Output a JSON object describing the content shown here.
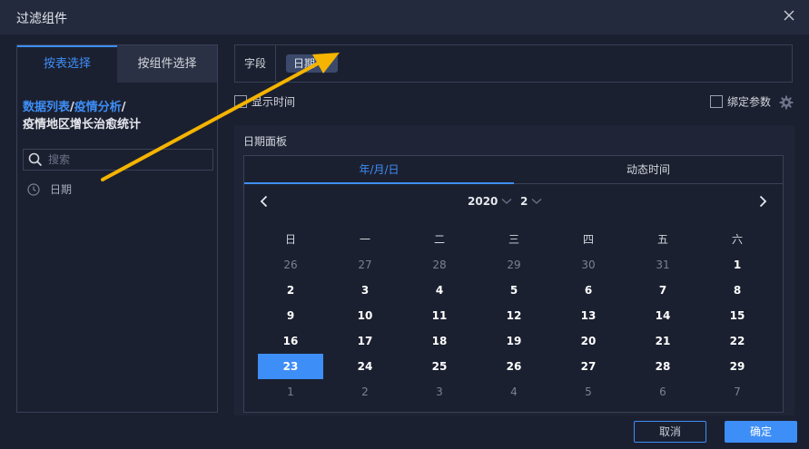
{
  "dialog": {
    "title": "过滤组件"
  },
  "left_panel": {
    "tabs": [
      {
        "label": "按表选择",
        "active": true
      },
      {
        "label": "按组件选择",
        "active": false
      }
    ],
    "breadcrumb": {
      "part1": "数据列表",
      "sep1": "/",
      "part2": "疫情分析",
      "sep2": "/",
      "part3": "疫情地区增长治愈统计"
    },
    "search": {
      "placeholder": "搜索",
      "value": ""
    },
    "fields": [
      {
        "label": "日期",
        "icon": "clock-icon"
      }
    ]
  },
  "field_row": {
    "label": "字段",
    "selected": "日期"
  },
  "options": {
    "show_time_label": "显示时间",
    "show_time_checked": false,
    "bind_param_label": "绑定参数",
    "bind_param_checked": false
  },
  "date_panel": {
    "title": "日期面板",
    "tabs": [
      {
        "label": "年/月/日",
        "active": true
      },
      {
        "label": "动态时间",
        "active": false
      }
    ],
    "year": "2020",
    "month": "2",
    "weekdays": [
      "日",
      "一",
      "二",
      "三",
      "四",
      "五",
      "六"
    ],
    "weeks": [
      [
        {
          "d": "26",
          "o": true
        },
        {
          "d": "27",
          "o": true
        },
        {
          "d": "28",
          "o": true
        },
        {
          "d": "29",
          "o": true
        },
        {
          "d": "30",
          "o": true
        },
        {
          "d": "31",
          "o": true
        },
        {
          "d": "1",
          "o": false
        }
      ],
      [
        {
          "d": "2",
          "o": false
        },
        {
          "d": "3",
          "o": false
        },
        {
          "d": "4",
          "o": false
        },
        {
          "d": "5",
          "o": false
        },
        {
          "d": "6",
          "o": false
        },
        {
          "d": "7",
          "o": false
        },
        {
          "d": "8",
          "o": false
        }
      ],
      [
        {
          "d": "9",
          "o": false
        },
        {
          "d": "10",
          "o": false
        },
        {
          "d": "11",
          "o": false
        },
        {
          "d": "12",
          "o": false
        },
        {
          "d": "13",
          "o": false
        },
        {
          "d": "14",
          "o": false
        },
        {
          "d": "15",
          "o": false
        }
      ],
      [
        {
          "d": "16",
          "o": false
        },
        {
          "d": "17",
          "o": false
        },
        {
          "d": "18",
          "o": false
        },
        {
          "d": "19",
          "o": false
        },
        {
          "d": "20",
          "o": false
        },
        {
          "d": "21",
          "o": false
        },
        {
          "d": "22",
          "o": false
        }
      ],
      [
        {
          "d": "23",
          "o": false,
          "sel": true
        },
        {
          "d": "24",
          "o": false
        },
        {
          "d": "25",
          "o": false
        },
        {
          "d": "26",
          "o": false
        },
        {
          "d": "27",
          "o": false
        },
        {
          "d": "28",
          "o": false
        },
        {
          "d": "29",
          "o": false
        }
      ],
      [
        {
          "d": "1",
          "o": true
        },
        {
          "d": "2",
          "o": true
        },
        {
          "d": "3",
          "o": true
        },
        {
          "d": "4",
          "o": true
        },
        {
          "d": "5",
          "o": true
        },
        {
          "d": "6",
          "o": true
        },
        {
          "d": "7",
          "o": true
        }
      ]
    ]
  },
  "footer": {
    "cancel_label": "取消",
    "ok_label": "确定"
  },
  "colors": {
    "accent": "#3e8ef7",
    "annotation_arrow": "#f5b400"
  }
}
